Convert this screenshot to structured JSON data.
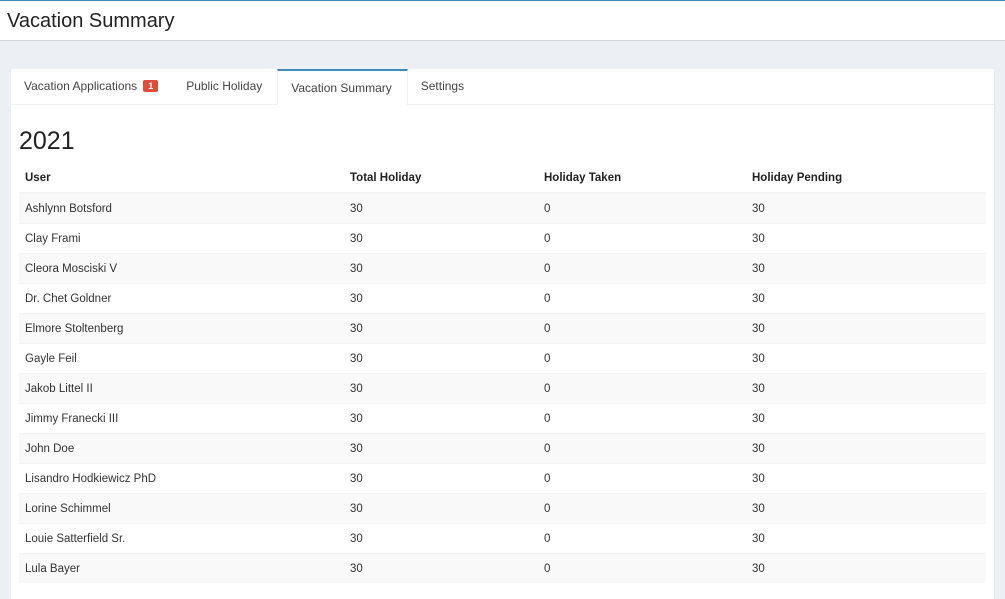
{
  "header": {
    "title": "Vacation Summary"
  },
  "tabs": [
    {
      "label": "Vacation Applications",
      "badge": "1"
    },
    {
      "label": "Public Holiday"
    },
    {
      "label": "Vacation Summary"
    },
    {
      "label": "Settings"
    }
  ],
  "summary": {
    "year": "2021",
    "columns": [
      "User",
      "Total Holiday",
      "Holiday Taken",
      "Holiday Pending"
    ],
    "rows": [
      [
        "Ashlynn Botsford",
        "30",
        "0",
        "30"
      ],
      [
        "Clay Frami",
        "30",
        "0",
        "30"
      ],
      [
        "Cleora Mosciski V",
        "30",
        "0",
        "30"
      ],
      [
        "Dr. Chet Goldner",
        "30",
        "0",
        "30"
      ],
      [
        "Elmore Stoltenberg",
        "30",
        "0",
        "30"
      ],
      [
        "Gayle Feil",
        "30",
        "0",
        "30"
      ],
      [
        "Jakob Littel II",
        "30",
        "0",
        "30"
      ],
      [
        "Jimmy Franecki III",
        "30",
        "0",
        "30"
      ],
      [
        "John Doe",
        "30",
        "0",
        "30"
      ],
      [
        "Lisandro Hodkiewicz PhD",
        "30",
        "0",
        "30"
      ],
      [
        "Lorine Schimmel",
        "30",
        "0",
        "30"
      ],
      [
        "Louie Satterfield Sr.",
        "30",
        "0",
        "30"
      ],
      [
        "Lula Bayer",
        "30",
        "0",
        "30"
      ]
    ]
  },
  "colors": {
    "accent": "#3c8dbc",
    "badge": "#dd4b39"
  }
}
